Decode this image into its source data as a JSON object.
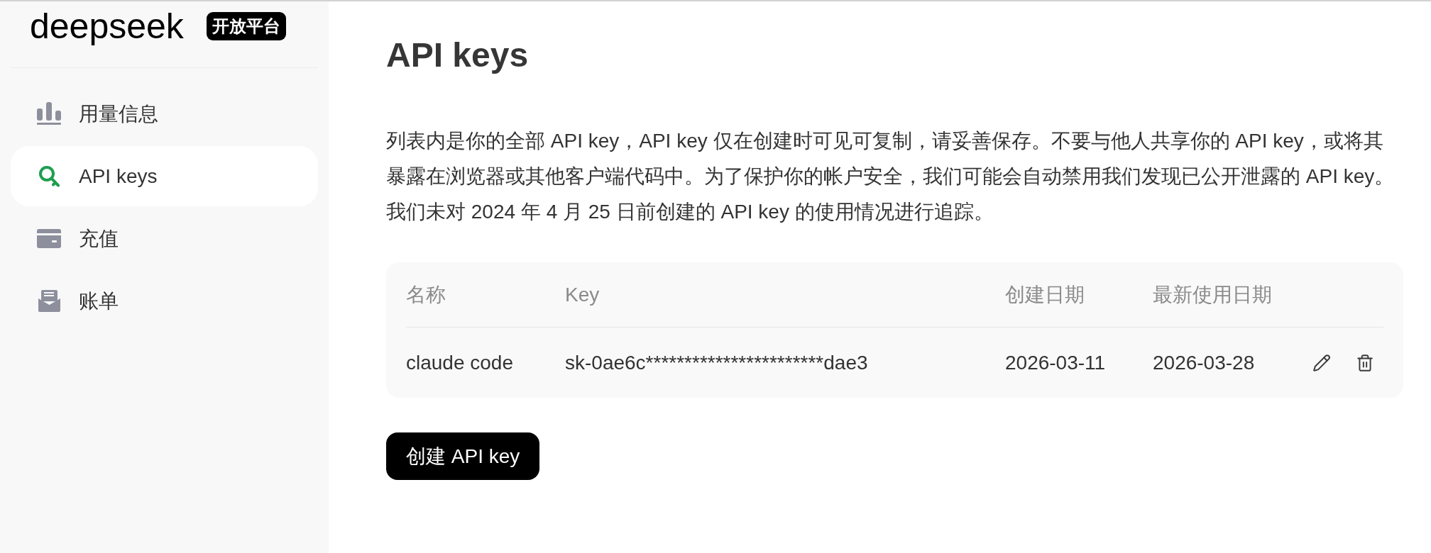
{
  "sidebar": {
    "logo": "deepseek",
    "badge": "开放平台",
    "items": [
      {
        "label": "用量信息",
        "selected": false
      },
      {
        "label": "API keys",
        "selected": true
      },
      {
        "label": "充值",
        "selected": false
      },
      {
        "label": "账单",
        "selected": false
      }
    ]
  },
  "main": {
    "title": "API keys",
    "description": "列表内是你的全部 API key，API key 仅在创建时可见可复制，请妥善保存。不要与他人共享你的 API key，或将其暴露在浏览器或其他客户端代码中。为了保护你的帐户安全，我们可能会自动禁用我们发现已公开泄露的 API key。我们未对 2024 年 4 月 25 日前创建的 API key 的使用情况进行追踪。",
    "table": {
      "columns": [
        "名称",
        "Key",
        "创建日期",
        "最新使用日期"
      ],
      "rows": [
        {
          "name": "claude code",
          "key": "sk-0ae6c***********************dae3",
          "created": "2026-03-11",
          "last_used": "2026-03-28"
        }
      ]
    },
    "create_button": "创建 API key"
  }
}
